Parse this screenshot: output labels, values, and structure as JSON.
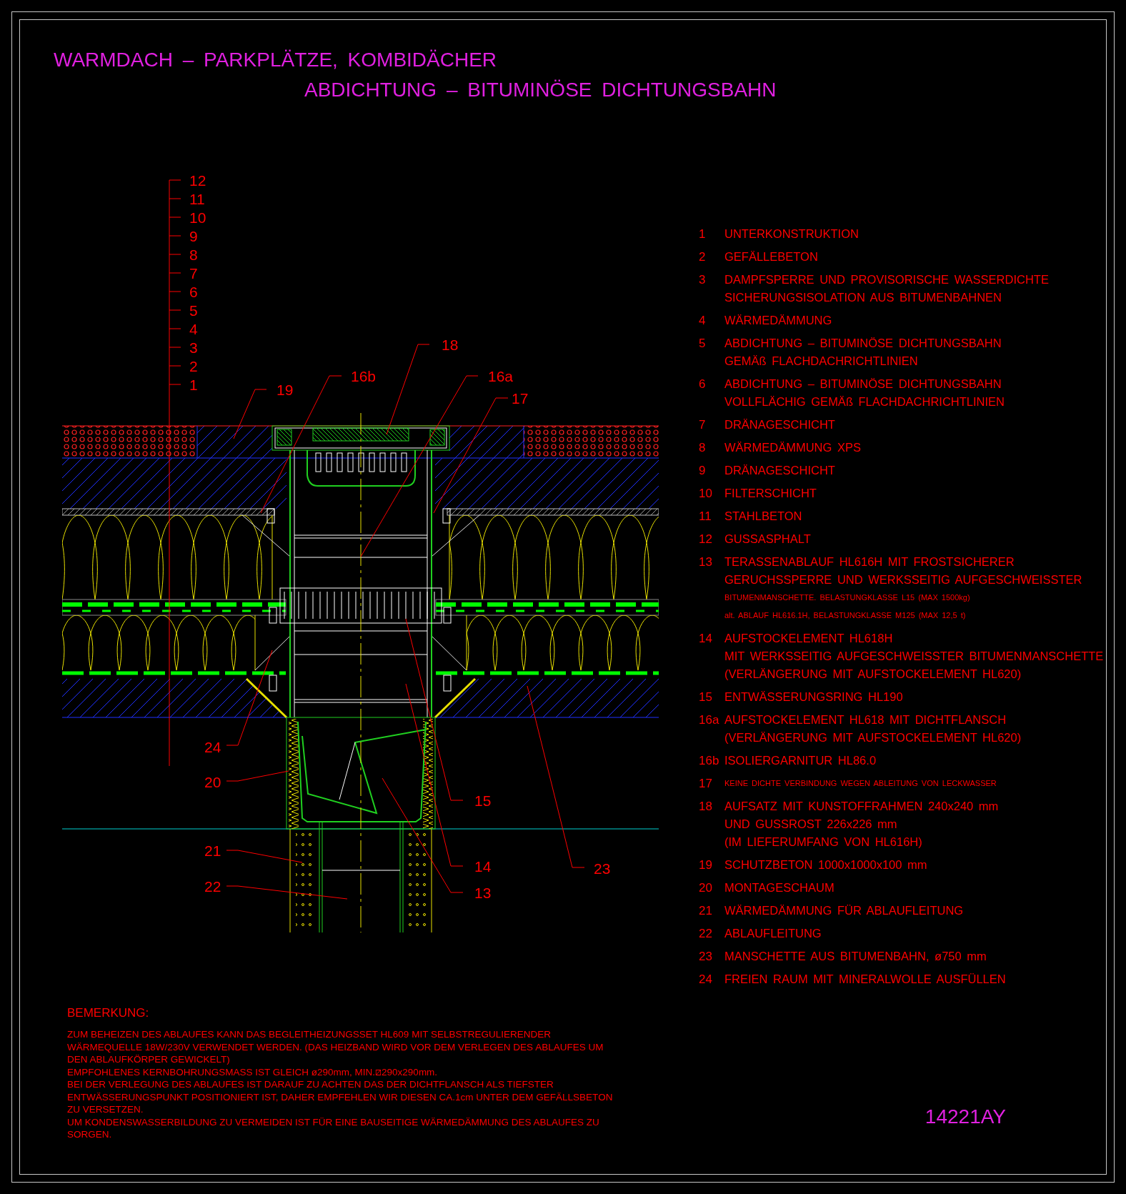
{
  "title": {
    "line_1": "WARMDACH – PARKPLÄTZE, KOMBIDÄCHER",
    "line_2": "ABDICHTUNG – BITUMINÖSE DICHTUNGSBAHN"
  },
  "drawing": {
    "scale_labels": [
      "12",
      "11",
      "10",
      "9",
      "8",
      "7",
      "6",
      "5",
      "4",
      "3",
      "2",
      "1"
    ],
    "callouts": [
      "19",
      "16b",
      "18",
      "16a",
      "17",
      "24",
      "20",
      "21",
      "22",
      "15",
      "14",
      "13",
      "23"
    ]
  },
  "legend": [
    {
      "number": "1",
      "lines": [
        {
          "kind": "main",
          "text": "UNTERKONSTRUKTION"
        }
      ]
    },
    {
      "number": "2",
      "lines": [
        {
          "kind": "main",
          "text": "GEFÄLLEBETON"
        }
      ]
    },
    {
      "number": "3",
      "lines": [
        {
          "kind": "main",
          "text": "DAMPFSPERRE UND PROVISORISCHE WASSERDICHTE"
        },
        {
          "kind": "main",
          "text": "SICHERUNGSISOLATION AUS BITUMENBAHNEN"
        }
      ]
    },
    {
      "number": "4",
      "lines": [
        {
          "kind": "main",
          "text": "WÄRMEDÄMMUNG"
        }
      ]
    },
    {
      "number": "5",
      "lines": [
        {
          "kind": "main",
          "text": "ABDICHTUNG – BITUMINÖSE DICHTUNGSBAHN"
        },
        {
          "kind": "main",
          "text": "GEMÄß FLACHDACHRICHTLINIEN"
        }
      ]
    },
    {
      "number": "6",
      "lines": [
        {
          "kind": "main",
          "text": "ABDICHTUNG – BITUMINÖSE DICHTUNGSBAHN"
        },
        {
          "kind": "main",
          "text": "VOLLFLÄCHIG GEMÄß FLACHDACHRICHTLINIEN"
        }
      ]
    },
    {
      "number": "7",
      "lines": [
        {
          "kind": "main",
          "text": "DRÄNAGESCHICHT"
        }
      ]
    },
    {
      "number": "8",
      "lines": [
        {
          "kind": "main",
          "text": "WÄRMEDÄMMUNG XPS"
        }
      ]
    },
    {
      "number": "9",
      "lines": [
        {
          "kind": "main",
          "text": "DRÄNAGESCHICHT"
        }
      ]
    },
    {
      "number": "10",
      "lines": [
        {
          "kind": "main",
          "text": "FILTERSCHICHT"
        }
      ]
    },
    {
      "number": "11",
      "lines": [
        {
          "kind": "main",
          "text": "STAHLBETON"
        }
      ]
    },
    {
      "number": "12",
      "lines": [
        {
          "kind": "main",
          "text": "GUSSASPHALT"
        }
      ]
    },
    {
      "number": "13",
      "lines": [
        {
          "kind": "main",
          "text": "TERASSENABLAUF HL616H MIT FROSTSICHERER"
        },
        {
          "kind": "main",
          "text": "GERUCHSSPERRE UND WERKSSEITIG AUFGESCHWEISSTER"
        },
        {
          "kind": "fine",
          "text": "BITUMENMANSCHETTE. BELASTUNGKLASSE L15 (MAX 1500kg)"
        },
        {
          "kind": "fine",
          "text": "alt. ABLAUF HL616.1H, BELASTUNGKLASSE M125 (MAX 12,5 t)"
        }
      ]
    },
    {
      "number": "14",
      "lines": [
        {
          "kind": "main",
          "text": "AUFSTOCKELEMENT HL618H"
        },
        {
          "kind": "main",
          "text": "MIT WERKSSEITIG AUFGESCHWEISSTER BITUMENMANSCHETTE"
        },
        {
          "kind": "main",
          "text": "(VERLÄNGERUNG MIT AUFSTOCKELEMENT HL620)"
        }
      ]
    },
    {
      "number": "15",
      "lines": [
        {
          "kind": "main",
          "text": "ENTWÄSSERUNGSRING HL190"
        }
      ]
    },
    {
      "number": "16a",
      "lines": [
        {
          "kind": "main",
          "text": "AUFSTOCKELEMENT HL618 MIT DICHTFLANSCH"
        },
        {
          "kind": "main",
          "text": "(VERLÄNGERUNG MIT AUFSTOCKELEMENT HL620)"
        }
      ]
    },
    {
      "number": "16b",
      "lines": [
        {
          "kind": "main",
          "text": "ISOLIERGARNITUR HL86.0"
        }
      ]
    },
    {
      "number": "17",
      "lines": [
        {
          "kind": "fine",
          "text": "KEINE DICHTE VERBINDUNG WEGEN ABLEITUNG VON LECKWASSER"
        }
      ]
    },
    {
      "number": "18",
      "lines": [
        {
          "kind": "main",
          "text": "AUFSATZ MIT KUNSTOFFRAHMEN 240x240 mm"
        },
        {
          "kind": "main",
          "text": "UND GUSSROST 226x226 mm"
        },
        {
          "kind": "main",
          "text": "(IM LIEFERUMFANG VON HL616H)"
        }
      ]
    },
    {
      "number": "19",
      "lines": [
        {
          "kind": "main",
          "text": "SCHUTZBETON 1000x1000x100 mm"
        }
      ]
    },
    {
      "number": "20",
      "lines": [
        {
          "kind": "main",
          "text": "MONTAGESCHAUM"
        }
      ]
    },
    {
      "number": "21",
      "lines": [
        {
          "kind": "main",
          "text": "WÄRMEDÄMMUNG FÜR ABLAUFLEITUNG"
        }
      ]
    },
    {
      "number": "22",
      "lines": [
        {
          "kind": "main",
          "text": "ABLAUFLEITUNG"
        }
      ]
    },
    {
      "number": "23",
      "lines": [
        {
          "kind": "main",
          "text": "MANSCHETTE AUS BITUMENBAHN, ø750 mm"
        }
      ]
    },
    {
      "number": "24",
      "lines": [
        {
          "kind": "main",
          "text": "FREIEN RAUM MIT MINERALWOLLE AUSFÜLLEN"
        }
      ]
    }
  ],
  "remarks": {
    "heading": "BEMERKUNG:",
    "paragraphs": [
      [
        "ZUM BEHEIZEN DES ABLAUFES KANN DAS BEGLEITHEIZUNGSSET HL609 MIT SELBSTREGULIERENDER",
        "WÄRMEQUELLE 18W/230V VERWENDET WERDEN. (DAS HEIZBAND WIRD VOR DEM VERLEGEN DES ABLAUFES UM",
        "DEN ABLAUFKÖRPER GEWICKELT)"
      ],
      [
        "EMPFOHLENES KERNBOHRUNGSMASS IST GLEICH ø290mm, MIN.⧄290x290mm."
      ],
      [
        "BEI DER VERLEGUNG DES ABLAUFES IST DARAUF ZU ACHTEN DAS DER DICHTFLANSCH ALS TIEFSTER",
        "ENTWÄSSERUNGSPUNKT POSITIONIERT IST, DAHER EMPFEHLEN WIR DIESEN CA.1cm UNTER DEM GEFÄLLSBETON",
        "ZU VERSETZEN."
      ],
      [
        "UM KONDENSWASSERBILDUNG ZU VERMEIDEN IST FÜR EINE BAUSEITIGE WÄRMEDÄMMUNG DES ABLAUFES ZU",
        "SORGEN."
      ]
    ]
  },
  "drawing_code": "14221AY"
}
